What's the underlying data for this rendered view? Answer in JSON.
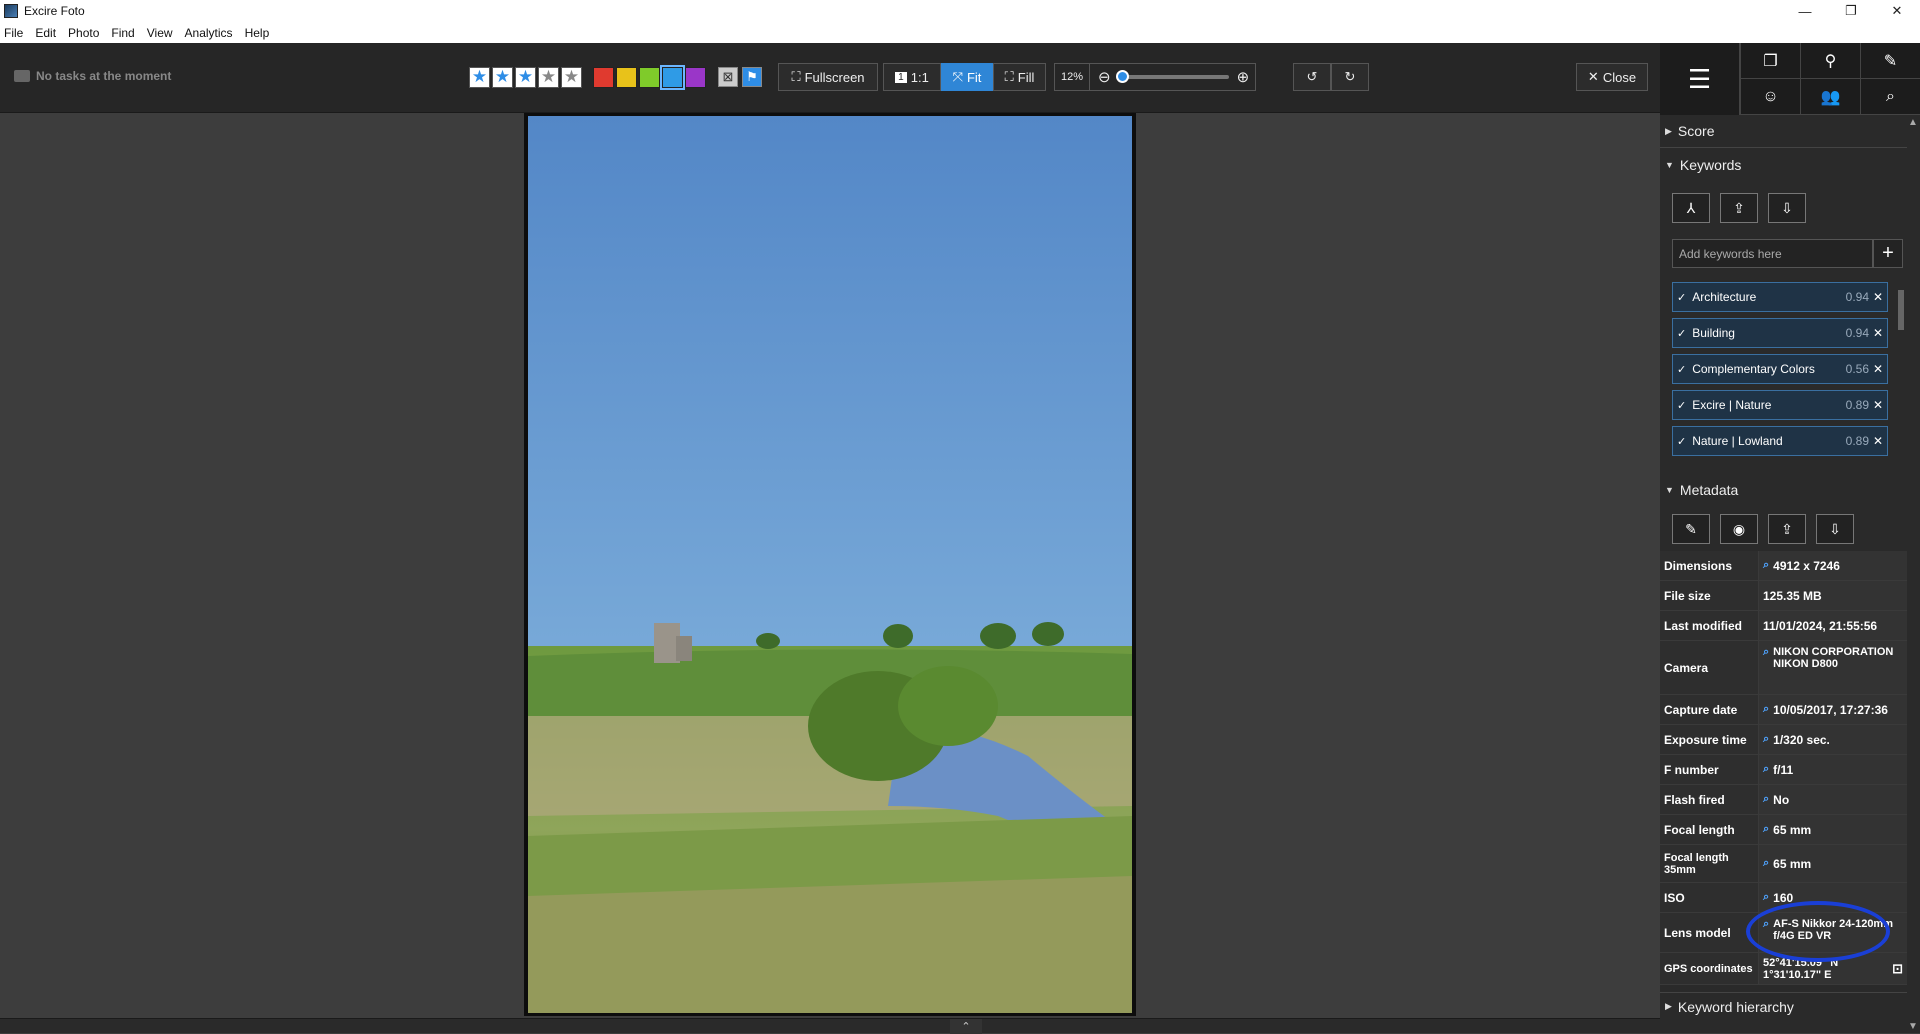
{
  "window": {
    "title": "Excire Foto",
    "minimize": "—",
    "maximize": "❐",
    "close": "✕"
  },
  "menu": [
    "File",
    "Edit",
    "Photo",
    "Find",
    "View",
    "Analytics",
    "Help"
  ],
  "toolbar": {
    "tasks": "No tasks at the moment",
    "rating": 3,
    "color_labels": [
      "#e03a2f",
      "#e8c21a",
      "#7fcb2a",
      "#2f9be6",
      "#9a36c8"
    ],
    "fullscreen": "Fullscreen",
    "one_to_one": "1:1",
    "fit": "Fit",
    "fill": "Fill",
    "zoom": "12%",
    "close": "Close"
  },
  "panel": {
    "score": "Score",
    "keywords": "Keywords",
    "keyword_placeholder": "Add keywords here",
    "keyword_list": [
      {
        "label": "Architecture",
        "score": "0.94"
      },
      {
        "label": "Building",
        "score": "0.94"
      },
      {
        "label": "Complementary Colors",
        "score": "0.56"
      },
      {
        "label": "Excire | Nature",
        "score": "0.89"
      },
      {
        "label": "Nature | Lowland",
        "score": "0.89"
      }
    ],
    "metadata": "Metadata",
    "metadata_rows": [
      {
        "key": "Dimensions",
        "value": "4912 x 7246",
        "search": true
      },
      {
        "key": "File size",
        "value": "125.35 MB",
        "search": false
      },
      {
        "key": "Last modified",
        "value": "11/01/2024, 21:55:56",
        "search": false
      },
      {
        "key": "Camera",
        "value": "NIKON CORPORATION NIKON D800",
        "search": true
      },
      {
        "key": "Capture date",
        "value": "10/05/2017, 17:27:36",
        "search": true
      },
      {
        "key": "Exposure time",
        "value": "1/320 sec.",
        "search": true
      },
      {
        "key": "F number",
        "value": "f/11",
        "search": true
      },
      {
        "key": "Flash fired",
        "value": "No",
        "search": true
      },
      {
        "key": "Focal length",
        "value": "65 mm",
        "search": true
      },
      {
        "key": "Focal length 35mm",
        "value": "65 mm",
        "search": true
      },
      {
        "key": "ISO",
        "value": "160",
        "search": true
      },
      {
        "key": "Lens model",
        "value": "AF-S Nikkor 24-120mm f/4G ED VR",
        "search": true
      },
      {
        "key": "GPS coordinates",
        "value": "52°41'15.09\" N 1°31'10.17\" E",
        "search": false
      }
    ],
    "keyword_hierarchy": "Keyword hierarchy"
  }
}
